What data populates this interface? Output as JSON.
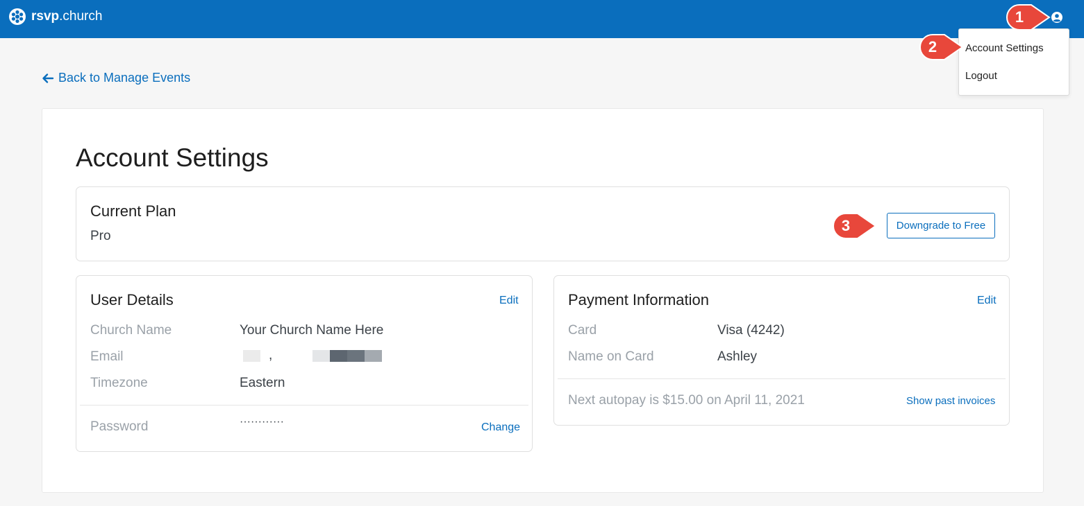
{
  "brand": {
    "name_bold": "rsvp",
    "name_rest": ".church"
  },
  "user_menu": {
    "items": [
      "Account Settings",
      "Logout"
    ]
  },
  "nav": {
    "back_label": "Back to Manage Events"
  },
  "page": {
    "title": "Account Settings"
  },
  "plan": {
    "title": "Current Plan",
    "value": "Pro",
    "action": "Downgrade to Free"
  },
  "user_details": {
    "title": "User Details",
    "edit": "Edit",
    "fields": [
      {
        "label": "Church Name",
        "value": "Your Church Name Here"
      },
      {
        "label": "Email",
        "value": ","
      },
      {
        "label": "Timezone",
        "value": "Eastern"
      }
    ],
    "password": {
      "label": "Password",
      "value": "············",
      "action": "Change"
    }
  },
  "payment": {
    "title": "Payment Information",
    "edit": "Edit",
    "fields": [
      {
        "label": "Card",
        "value": "Visa (4242)"
      },
      {
        "label": "Name on Card",
        "value": "Ashley"
      }
    ],
    "autopay": "Next autopay is $15.00 on April 11, 2021",
    "invoices": "Show past invoices"
  },
  "callouts": [
    "1",
    "2",
    "3"
  ],
  "colors": {
    "topbar": "#0a6ebd",
    "link": "#0a6ebd",
    "callout": "#e8473b"
  }
}
